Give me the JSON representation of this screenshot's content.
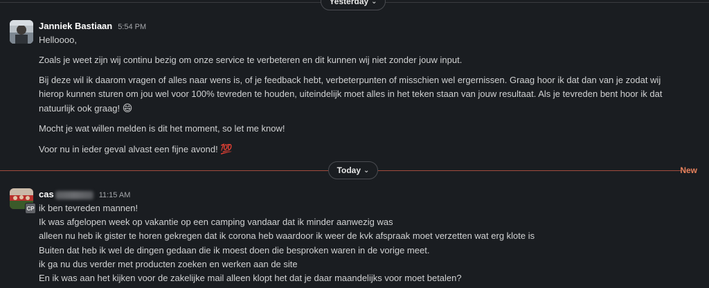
{
  "dividers": {
    "yesterday": "Yesterday",
    "today": "Today",
    "new": "New"
  },
  "colors": {
    "background": "#1a1d21",
    "new_divider": "#e8825d"
  },
  "messages": [
    {
      "author": "Janniek Bastiaan",
      "time": "5:54 PM",
      "paragraphs": [
        "Helloooo,",
        "Zoals je weet zijn wij continu bezig om onze service te verbeteren en dit kunnen wij niet zonder jouw input.",
        "Bij deze wil ik daarom vragen of alles naar wens is, of je feedback hebt, verbeterpunten of misschien wel ergernissen. Graag hoor ik dat dan van je zodat wij",
        "hierop kunnen sturen om jou wel voor 100% tevreden te houden, uiteindelijk moet alles in het teken staan van jouw resultaat. Als je tevreden bent hoor ik dat",
        "natuurlijk ook graag! ",
        "Mocht je wat willen melden is dit het moment, so let me know!",
        "Voor nu in ieder geval alvast een fijne avond! "
      ],
      "emoji_grin": "😄",
      "emoji_100": "💯"
    },
    {
      "author": "cas",
      "time": "11:15 AM",
      "badge": "CP",
      "lines": [
        "ik ben tevreden mannen!",
        "Ik was afgelopen week op vakantie op een camping vandaar dat ik minder aanwezig was",
        "alleen nu heb ik gister te horen gekregen dat ik corona heb waardoor ik weer de kvk afspraak moet verzetten wat erg klote is",
        "Buiten dat heb ik wel de dingen gedaan die ik moest doen die besproken waren in de vorige meet.",
        "ik ga nu dus verder met producten zoeken en werken aan de site",
        "En ik was aan het kijken voor de zakelijke mail alleen klopt het dat je daar maandelijks voor moet betalen?"
      ]
    }
  ]
}
